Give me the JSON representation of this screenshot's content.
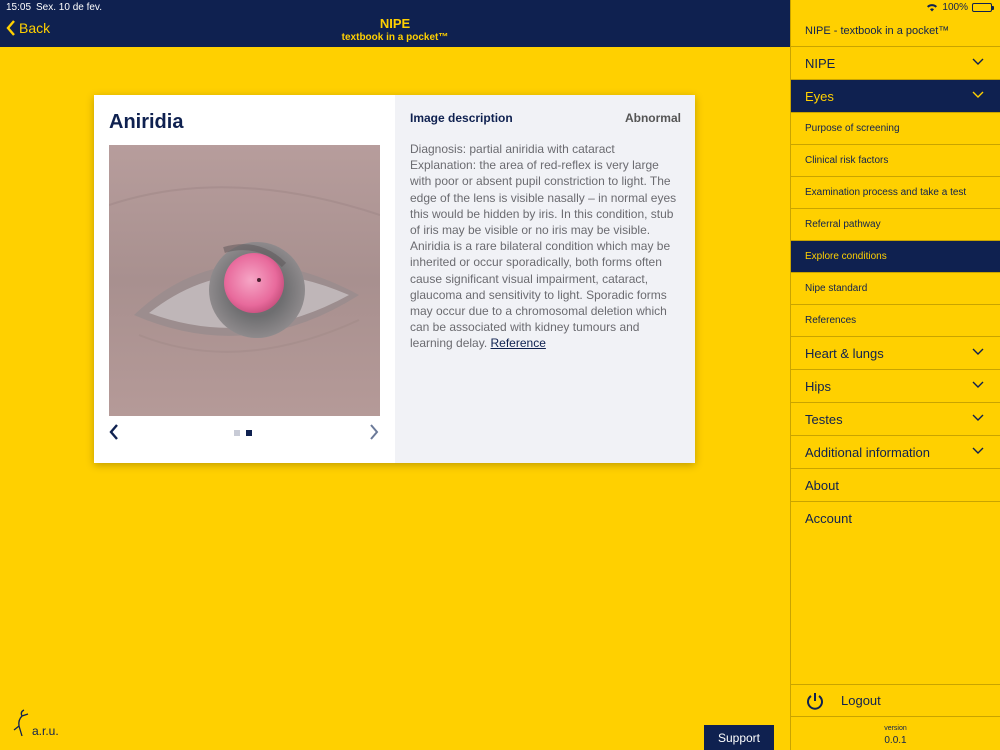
{
  "status_bar": {
    "time": "15:05",
    "date": "Sex. 10 de fev.",
    "battery": "100%",
    "battery_level": 1.0
  },
  "topbar": {
    "back_label": "Back",
    "title": "NIPE",
    "subtitle": "textbook in a pocket™"
  },
  "card": {
    "title": "Aniridia",
    "desc_heading": "Image description",
    "status": "Abnormal",
    "description": "Diagnosis: partial aniridia with cataract Explanation: the area of red-reflex is very large with poor or absent pupil constriction to light. The edge of the lens is visible nasally – in normal eyes this would be hidden by iris. In this condition, stub of iris may be visible or no iris may be visible. Aniridia is a rare bilateral condition which may be inherited or occur sporadically, both forms often cause significant visual impairment, cataract, glaucoma and sensitivity to light. Sporadic forms may occur due to a chromosomal deletion which can be associated with kidney tumours and learning delay. ",
    "reference_label": "Reference",
    "image_count": 2,
    "active_image": 2
  },
  "sidebar": {
    "header": "NIPE - textbook in a pocket™",
    "items": [
      {
        "label": "NIPE"
      },
      {
        "label": "Eyes"
      },
      {
        "label": "Purpose of screening"
      },
      {
        "label": "Clinical risk factors"
      },
      {
        "label": "Examination process and take a test"
      },
      {
        "label": "Referral pathway"
      },
      {
        "label": "Explore conditions"
      },
      {
        "label": "Nipe standard"
      },
      {
        "label": "References"
      },
      {
        "label": "Heart & lungs"
      },
      {
        "label": "Hips"
      },
      {
        "label": "Testes"
      },
      {
        "label": "Additional information"
      },
      {
        "label": "About"
      },
      {
        "label": "Account"
      }
    ],
    "logout_label": "Logout",
    "version_label": "version",
    "version_number": "0.0.1"
  },
  "footer": {
    "logo_text": "a.r.u.",
    "support_label": "Support"
  },
  "colors": {
    "navy": "#0F2150",
    "yellow": "#FFD000",
    "panel": "#F1F2F6"
  }
}
